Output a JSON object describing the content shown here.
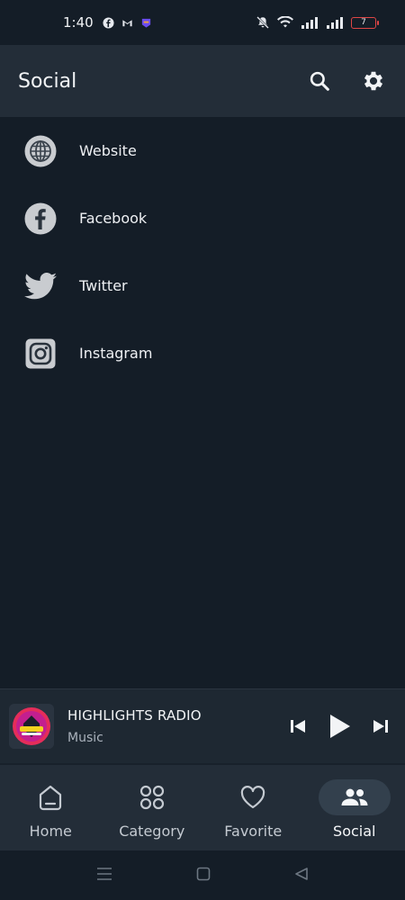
{
  "status_bar": {
    "time": "1:40",
    "battery_level": "7"
  },
  "app_bar": {
    "title": "Social"
  },
  "social_links": [
    {
      "label": "Website",
      "icon": "globe-icon"
    },
    {
      "label": "Facebook",
      "icon": "facebook-icon"
    },
    {
      "label": "Twitter",
      "icon": "twitter-icon"
    },
    {
      "label": "Instagram",
      "icon": "instagram-icon"
    }
  ],
  "player": {
    "title": "HIGHLIGHTS RADIO",
    "subtitle": "Music"
  },
  "bottom_nav": {
    "items": [
      {
        "label": "Home",
        "icon": "home-icon"
      },
      {
        "label": "Category",
        "icon": "category-icon"
      },
      {
        "label": "Favorite",
        "icon": "heart-icon"
      },
      {
        "label": "Social",
        "icon": "people-icon"
      }
    ],
    "active": "Social"
  },
  "colors": {
    "background": "#141d27",
    "app_bar": "#232d38",
    "player": "#1e2832",
    "battery_low": "#e04646",
    "active_nav_pill": "#33404d"
  }
}
